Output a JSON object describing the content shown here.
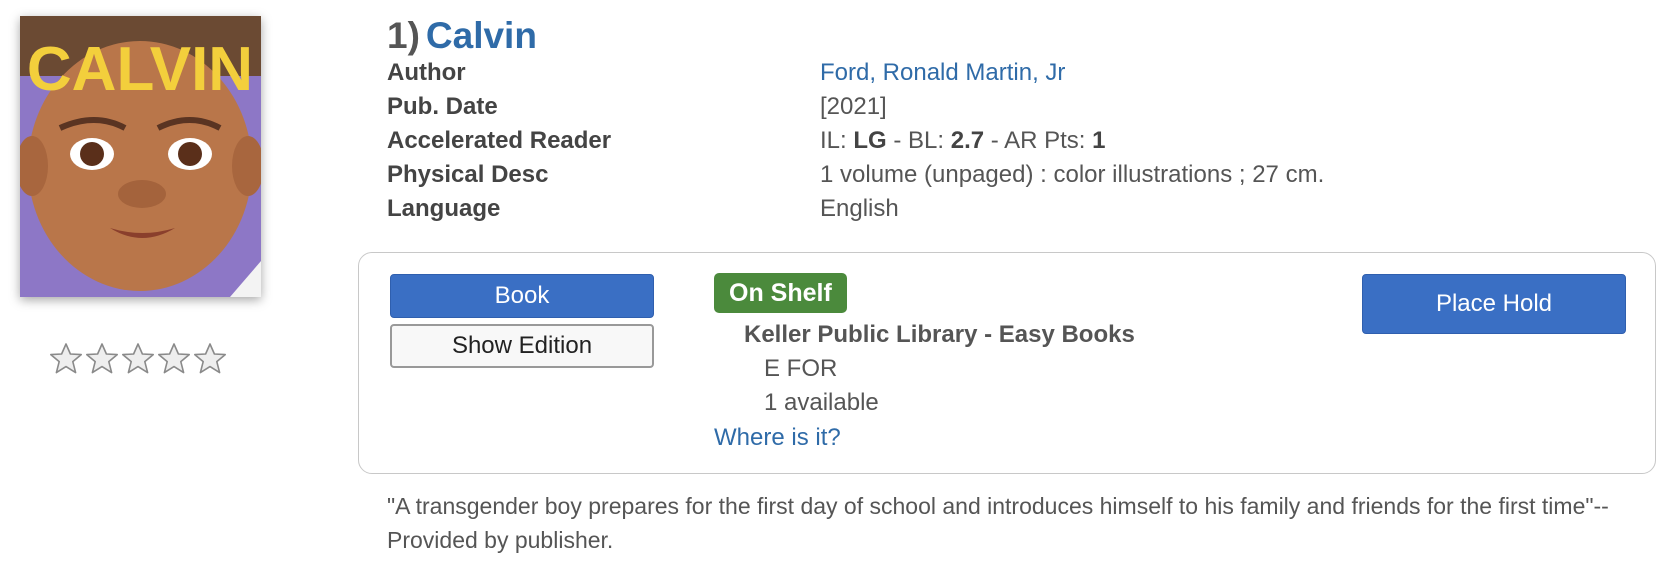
{
  "cover": {
    "title_text": "CALVIN",
    "colors": {
      "background": "#8d77c6",
      "title": "#f3cf3c",
      "skin": "#b9764a"
    }
  },
  "rating": {
    "stars": [
      {
        "name": "star-icon"
      },
      {
        "name": "star-icon"
      },
      {
        "name": "star-icon"
      },
      {
        "name": "star-icon"
      },
      {
        "name": "star-icon"
      }
    ],
    "value": 0,
    "max": 5
  },
  "title": {
    "number": "1)",
    "text": "Calvin"
  },
  "details": [
    {
      "label": "Author",
      "value": "Ford, Ronald Martin, Jr"
    },
    {
      "label": "Pub. Date",
      "value": "[2021]"
    },
    {
      "label": "Accelerated Reader",
      "il_label": "IL:",
      "il": "LG",
      "bl_label": "- BL:",
      "bl": "2.7",
      "ar_label": "- AR Pts:",
      "ar": "1"
    },
    {
      "label": "Physical Desc",
      "value": "1 volume (unpaged) : color illustrations ; 27 cm."
    },
    {
      "label": "Language",
      "value": "English"
    }
  ],
  "holdings": {
    "format_label": "Book",
    "edition_label": "Show Edition",
    "status": "On Shelf",
    "location": "Keller Public Library - Easy Books",
    "call_number": "E FOR",
    "availability": "1 available",
    "where_link": "Where is it?",
    "hold_label": "Place Hold"
  },
  "summary": "\"A transgender boy prepares for the first day of school and introduces himself to his family and friends for the first time\"-- Provided by publisher.",
  "colors": {
    "link": "#2f6ba8",
    "primary_button": "#3a6fc4",
    "status_green": "#4b8a3c"
  }
}
